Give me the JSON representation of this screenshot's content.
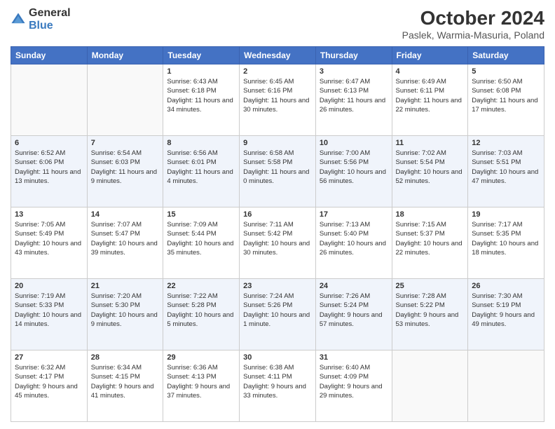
{
  "header": {
    "logo_general": "General",
    "logo_blue": "Blue",
    "title": "October 2024",
    "subtitle": "Paslek, Warmia-Masuria, Poland"
  },
  "days_of_week": [
    "Sunday",
    "Monday",
    "Tuesday",
    "Wednesday",
    "Thursday",
    "Friday",
    "Saturday"
  ],
  "weeks": [
    [
      {
        "day": "",
        "sunrise": "",
        "sunset": "",
        "daylight": ""
      },
      {
        "day": "",
        "sunrise": "",
        "sunset": "",
        "daylight": ""
      },
      {
        "day": "1",
        "sunrise": "Sunrise: 6:43 AM",
        "sunset": "Sunset: 6:18 PM",
        "daylight": "Daylight: 11 hours and 34 minutes."
      },
      {
        "day": "2",
        "sunrise": "Sunrise: 6:45 AM",
        "sunset": "Sunset: 6:16 PM",
        "daylight": "Daylight: 11 hours and 30 minutes."
      },
      {
        "day": "3",
        "sunrise": "Sunrise: 6:47 AM",
        "sunset": "Sunset: 6:13 PM",
        "daylight": "Daylight: 11 hours and 26 minutes."
      },
      {
        "day": "4",
        "sunrise": "Sunrise: 6:49 AM",
        "sunset": "Sunset: 6:11 PM",
        "daylight": "Daylight: 11 hours and 22 minutes."
      },
      {
        "day": "5",
        "sunrise": "Sunrise: 6:50 AM",
        "sunset": "Sunset: 6:08 PM",
        "daylight": "Daylight: 11 hours and 17 minutes."
      }
    ],
    [
      {
        "day": "6",
        "sunrise": "Sunrise: 6:52 AM",
        "sunset": "Sunset: 6:06 PM",
        "daylight": "Daylight: 11 hours and 13 minutes."
      },
      {
        "day": "7",
        "sunrise": "Sunrise: 6:54 AM",
        "sunset": "Sunset: 6:03 PM",
        "daylight": "Daylight: 11 hours and 9 minutes."
      },
      {
        "day": "8",
        "sunrise": "Sunrise: 6:56 AM",
        "sunset": "Sunset: 6:01 PM",
        "daylight": "Daylight: 11 hours and 4 minutes."
      },
      {
        "day": "9",
        "sunrise": "Sunrise: 6:58 AM",
        "sunset": "Sunset: 5:58 PM",
        "daylight": "Daylight: 11 hours and 0 minutes."
      },
      {
        "day": "10",
        "sunrise": "Sunrise: 7:00 AM",
        "sunset": "Sunset: 5:56 PM",
        "daylight": "Daylight: 10 hours and 56 minutes."
      },
      {
        "day": "11",
        "sunrise": "Sunrise: 7:02 AM",
        "sunset": "Sunset: 5:54 PM",
        "daylight": "Daylight: 10 hours and 52 minutes."
      },
      {
        "day": "12",
        "sunrise": "Sunrise: 7:03 AM",
        "sunset": "Sunset: 5:51 PM",
        "daylight": "Daylight: 10 hours and 47 minutes."
      }
    ],
    [
      {
        "day": "13",
        "sunrise": "Sunrise: 7:05 AM",
        "sunset": "Sunset: 5:49 PM",
        "daylight": "Daylight: 10 hours and 43 minutes."
      },
      {
        "day": "14",
        "sunrise": "Sunrise: 7:07 AM",
        "sunset": "Sunset: 5:47 PM",
        "daylight": "Daylight: 10 hours and 39 minutes."
      },
      {
        "day": "15",
        "sunrise": "Sunrise: 7:09 AM",
        "sunset": "Sunset: 5:44 PM",
        "daylight": "Daylight: 10 hours and 35 minutes."
      },
      {
        "day": "16",
        "sunrise": "Sunrise: 7:11 AM",
        "sunset": "Sunset: 5:42 PM",
        "daylight": "Daylight: 10 hours and 30 minutes."
      },
      {
        "day": "17",
        "sunrise": "Sunrise: 7:13 AM",
        "sunset": "Sunset: 5:40 PM",
        "daylight": "Daylight: 10 hours and 26 minutes."
      },
      {
        "day": "18",
        "sunrise": "Sunrise: 7:15 AM",
        "sunset": "Sunset: 5:37 PM",
        "daylight": "Daylight: 10 hours and 22 minutes."
      },
      {
        "day": "19",
        "sunrise": "Sunrise: 7:17 AM",
        "sunset": "Sunset: 5:35 PM",
        "daylight": "Daylight: 10 hours and 18 minutes."
      }
    ],
    [
      {
        "day": "20",
        "sunrise": "Sunrise: 7:19 AM",
        "sunset": "Sunset: 5:33 PM",
        "daylight": "Daylight: 10 hours and 14 minutes."
      },
      {
        "day": "21",
        "sunrise": "Sunrise: 7:20 AM",
        "sunset": "Sunset: 5:30 PM",
        "daylight": "Daylight: 10 hours and 9 minutes."
      },
      {
        "day": "22",
        "sunrise": "Sunrise: 7:22 AM",
        "sunset": "Sunset: 5:28 PM",
        "daylight": "Daylight: 10 hours and 5 minutes."
      },
      {
        "day": "23",
        "sunrise": "Sunrise: 7:24 AM",
        "sunset": "Sunset: 5:26 PM",
        "daylight": "Daylight: 10 hours and 1 minute."
      },
      {
        "day": "24",
        "sunrise": "Sunrise: 7:26 AM",
        "sunset": "Sunset: 5:24 PM",
        "daylight": "Daylight: 9 hours and 57 minutes."
      },
      {
        "day": "25",
        "sunrise": "Sunrise: 7:28 AM",
        "sunset": "Sunset: 5:22 PM",
        "daylight": "Daylight: 9 hours and 53 minutes."
      },
      {
        "day": "26",
        "sunrise": "Sunrise: 7:30 AM",
        "sunset": "Sunset: 5:19 PM",
        "daylight": "Daylight: 9 hours and 49 minutes."
      }
    ],
    [
      {
        "day": "27",
        "sunrise": "Sunrise: 6:32 AM",
        "sunset": "Sunset: 4:17 PM",
        "daylight": "Daylight: 9 hours and 45 minutes."
      },
      {
        "day": "28",
        "sunrise": "Sunrise: 6:34 AM",
        "sunset": "Sunset: 4:15 PM",
        "daylight": "Daylight: 9 hours and 41 minutes."
      },
      {
        "day": "29",
        "sunrise": "Sunrise: 6:36 AM",
        "sunset": "Sunset: 4:13 PM",
        "daylight": "Daylight: 9 hours and 37 minutes."
      },
      {
        "day": "30",
        "sunrise": "Sunrise: 6:38 AM",
        "sunset": "Sunset: 4:11 PM",
        "daylight": "Daylight: 9 hours and 33 minutes."
      },
      {
        "day": "31",
        "sunrise": "Sunrise: 6:40 AM",
        "sunset": "Sunset: 4:09 PM",
        "daylight": "Daylight: 9 hours and 29 minutes."
      },
      {
        "day": "",
        "sunrise": "",
        "sunset": "",
        "daylight": ""
      },
      {
        "day": "",
        "sunrise": "",
        "sunset": "",
        "daylight": ""
      }
    ]
  ]
}
